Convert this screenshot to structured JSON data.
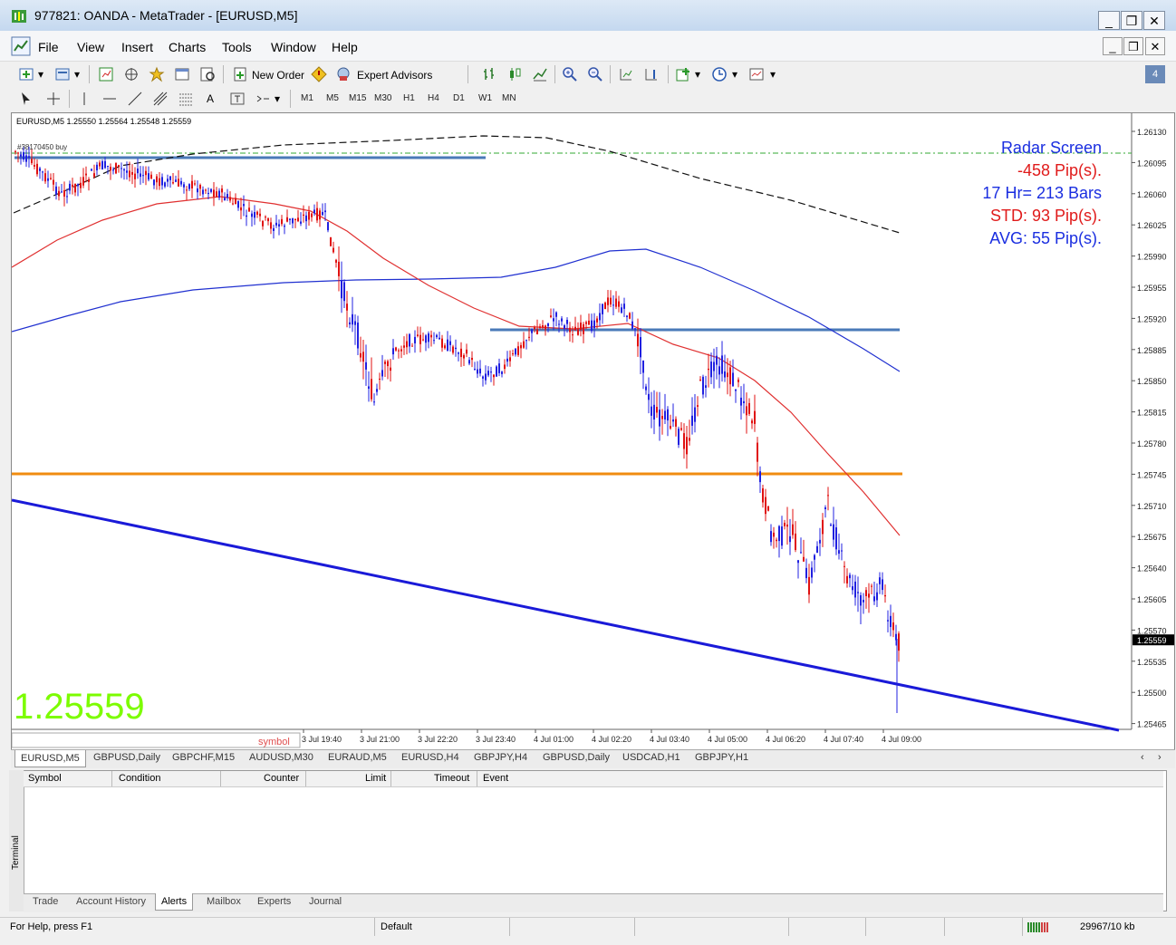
{
  "window": {
    "title": "977821: OANDA - MetaTrader - [EURUSD,M5]",
    "controls": [
      "_",
      "❐",
      "✕"
    ]
  },
  "menu": [
    "File",
    "View",
    "Insert",
    "Charts",
    "Tools",
    "Window",
    "Help"
  ],
  "toolbar": {
    "new_order": "New Order",
    "expert_advisors": "Expert Advisors",
    "badge": "4"
  },
  "timeframes": [
    "M1",
    "M5",
    "M15",
    "M30",
    "H1",
    "H4",
    "D1",
    "W1",
    "MN"
  ],
  "chart": {
    "header": "EURUSD,M5  1.25550 1.25564 1.25548 1.25559",
    "order_label": "#38170450 buy",
    "big_price": "1.25559",
    "symbol_label": "symbol",
    "current_price_tag": "1.25559",
    "price_labels": [
      "1.26130",
      "1.26095",
      "1.26060",
      "1.26025",
      "1.25990",
      "1.25955",
      "1.25920",
      "1.25885",
      "1.25850",
      "1.25815",
      "1.25780",
      "1.25745",
      "1.25710",
      "1.25675",
      "1.25640",
      "1.25605",
      "1.25570",
      "1.25535",
      "1.25500",
      "1.25465"
    ],
    "time_labels": [
      "3 Jul 19:40",
      "3 Jul 21:00",
      "3 Jul 22:20",
      "3 Jul 23:40",
      "4 Jul 01:00",
      "4 Jul 02:20",
      "4 Jul 03:40",
      "4 Jul 05:00",
      "4 Jul 06:20",
      "4 Jul 07:40",
      "4 Jul 09:00"
    ],
    "radar": [
      {
        "text": "Radar Screen",
        "color": "#1a2ee0"
      },
      {
        "text": "-458 Pip(s).",
        "color": "#e01a1a"
      },
      {
        "text": "17 Hr= 213 Bars",
        "color": "#1a2ee0"
      },
      {
        "text": "STD: 93 Pip(s).",
        "color": "#e01a1a"
      },
      {
        "text": "AVG: 55 Pip(s).",
        "color": "#1a2ee0"
      }
    ],
    "colors": {
      "bull": "#2020e0",
      "bear": "#e01010",
      "ma_fast": "#e03030",
      "ma_slow": "#2030d0",
      "trendline": "#1a1ad8",
      "support": "#f08c10",
      "hline": "#4a7ab8",
      "big_price": "#7cfc00"
    }
  },
  "chart_tabs": [
    "EURUSD,M5",
    "GBPUSD,Daily",
    "GBPCHF,M15",
    "AUDUSD,M30",
    "EURAUD,M5",
    "EURUSD,H4",
    "GBPJPY,H4",
    "GBPUSD,Daily",
    "USDCAD,H1",
    "GBPJPY,H1"
  ],
  "terminal": {
    "side_label": "Terminal",
    "columns": [
      "Symbol",
      "Condition",
      "Counter",
      "Limit",
      "Timeout",
      "Event"
    ],
    "tabs": [
      "Trade",
      "Account History",
      "Alerts",
      "Mailbox",
      "Experts",
      "Journal"
    ],
    "active_tab": "Alerts"
  },
  "status": {
    "help": "For Help, press F1",
    "profile": "Default",
    "traffic": "29967/10 kb"
  }
}
